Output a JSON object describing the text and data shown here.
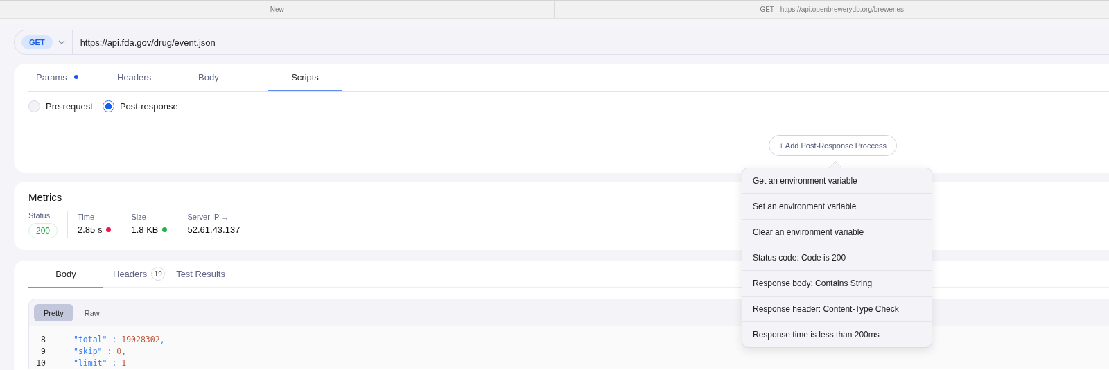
{
  "window_tabs": [
    {
      "title": "New"
    },
    {
      "title": "GET - https://api.openbrewerydb.org/breweries"
    }
  ],
  "request": {
    "method": "GET",
    "url": "https://api.fda.gov/drug/event.json"
  },
  "request_tabs": [
    {
      "label": "Params",
      "selected": false,
      "modified": true
    },
    {
      "label": "Headers",
      "selected": false,
      "modified": false
    },
    {
      "label": "Body",
      "selected": false,
      "modified": false
    },
    {
      "label": "Scripts",
      "selected": true,
      "modified": false
    }
  ],
  "script_modes": [
    {
      "label": "Pre-request",
      "selected": false
    },
    {
      "label": "Post-response",
      "selected": true
    }
  ],
  "add_button": {
    "icon": "+",
    "label": "Add Post-Response Proccess"
  },
  "menu": {
    "items": [
      "Get an environment variable",
      "Set an environment variable",
      "Clear an environment variable",
      "Status code: Code is 200",
      "Response body: Contains String",
      "Response header: Content-Type Check",
      "Response time is less than 200ms"
    ]
  },
  "metrics": {
    "title": "Metrics",
    "items": [
      {
        "kind": "badge",
        "label": "Status",
        "value": "200",
        "color": "#1aaa3a"
      },
      {
        "kind": "dot",
        "label": "Time",
        "value": "2.85 s",
        "color": "#f0164f"
      },
      {
        "kind": "dot",
        "label": "Size",
        "value": "1.8 KB",
        "color": "#22b244"
      },
      {
        "kind": "plain",
        "label": "Server IP →",
        "value": "52.61.43.137"
      }
    ]
  },
  "response_tabs": [
    {
      "label": "Body",
      "selected": true
    },
    {
      "label": "Headers",
      "selected": false,
      "count": "19"
    },
    {
      "label": "Test Results",
      "selected": false
    }
  ],
  "view_modes": [
    {
      "label": "Pretty",
      "selected": true
    },
    {
      "label": "Raw",
      "selected": false
    }
  ],
  "code_lines": [
    {
      "number": "8",
      "tokens": [
        {
          "kind": "key",
          "text": "\"total\""
        },
        {
          "kind": "punct",
          "text": " : "
        },
        {
          "kind": "number",
          "text": "19028302"
        },
        {
          "kind": "punct",
          "text": ","
        }
      ]
    },
    {
      "number": "9",
      "tokens": [
        {
          "kind": "key",
          "text": "\"skip\""
        },
        {
          "kind": "punct",
          "text": " : "
        },
        {
          "kind": "number",
          "text": "0"
        },
        {
          "kind": "punct",
          "text": ","
        }
      ]
    },
    {
      "number": "10",
      "tokens": [
        {
          "kind": "key",
          "text": "\"limit\""
        },
        {
          "kind": "punct",
          "text": " : "
        },
        {
          "kind": "number",
          "text": "1"
        }
      ]
    }
  ]
}
